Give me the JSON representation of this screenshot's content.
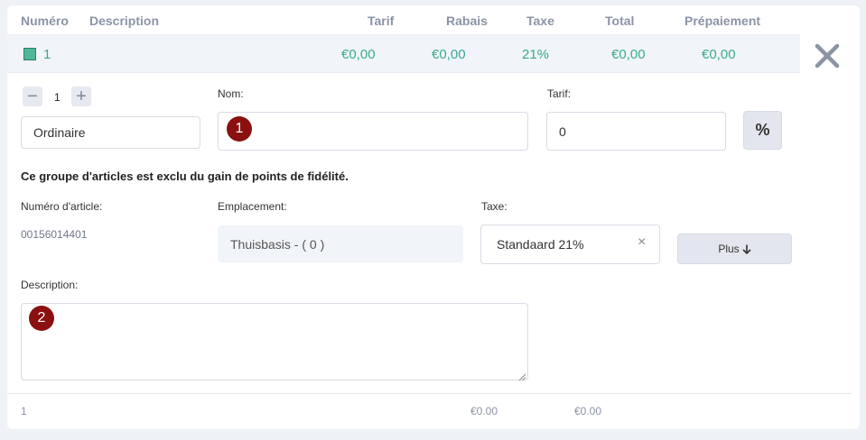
{
  "header": {
    "numero": "Numéro",
    "description": "Description",
    "tarif": "Tarif",
    "rabais": "Rabais",
    "taxe": "Taxe",
    "total": "Total",
    "prepaiement": "Prépaiement"
  },
  "row": {
    "numero": "1",
    "tarif": "€0,00",
    "rabais": "€0,00",
    "taxe": "21%",
    "total": "€0,00",
    "prepaiement": "€0,00"
  },
  "qty": {
    "value": "1"
  },
  "type_field": {
    "value": "Ordinaire"
  },
  "labels": {
    "nom": "Nom:",
    "tarif": "Tarif:",
    "numero_article": "Numéro d'article:",
    "emplacement": "Emplacement:",
    "taxe": "Taxe:",
    "description": "Description:"
  },
  "tarif_field": {
    "value": "0"
  },
  "percent_button": "%",
  "loyalty_notice": "Ce groupe d'articles est exclu du gain de points de fidélité.",
  "article_number": "00156014401",
  "emplacement_value": "Thuisbasis - ( 0 )",
  "tax_select": {
    "value": "Standaard 21%",
    "clear": "×"
  },
  "plus_button": "Plus",
  "badges": {
    "one": "1",
    "two": "2"
  },
  "footer": {
    "count": "1",
    "amount1": "€0.00",
    "amount2": "€0.00"
  },
  "colors": {
    "accent": "#3aa98f",
    "badge": "#8b1010"
  }
}
